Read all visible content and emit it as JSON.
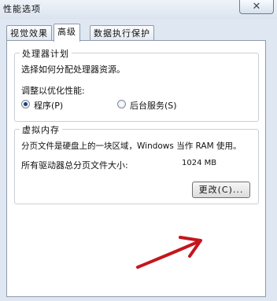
{
  "window": {
    "title": "性能选项",
    "close_glyph": "✕"
  },
  "tabs": [
    {
      "label": "视觉效果",
      "active": false
    },
    {
      "label": "高级",
      "active": true
    },
    {
      "label": "数据执行保护",
      "active": false
    }
  ],
  "processor_scheduling": {
    "group_title": "处理器计划",
    "description": "选择如何分配处理器资源。",
    "optimize_label": "调整以优化性能:",
    "options": [
      {
        "label": "程序(P)",
        "selected": true
      },
      {
        "label": "后台服务(S)",
        "selected": false
      }
    ]
  },
  "virtual_memory": {
    "group_title": "虚拟内存",
    "description": "分页文件是硬盘上的一块区域，Windows 当作 RAM 使用。",
    "total_label": "所有驱动器总分页文件大小:",
    "total_value": "1024 MB",
    "change_button_label": "更改(C)..."
  },
  "annotation": {
    "arrow_color": "#c4161c",
    "icon": "red-arrow-annotation"
  }
}
